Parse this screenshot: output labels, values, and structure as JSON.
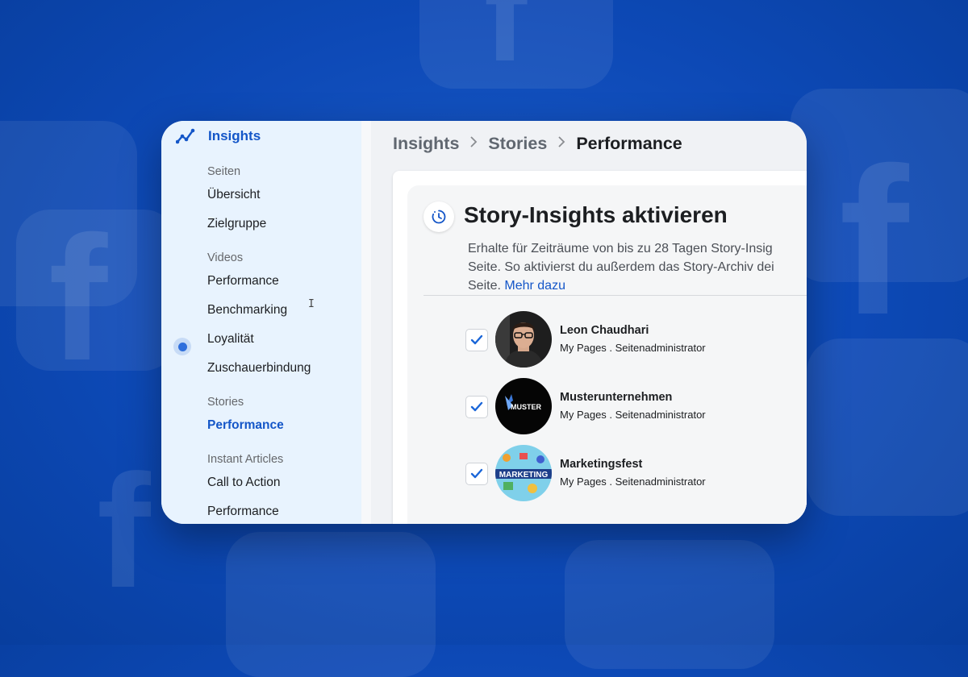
{
  "sidebar": {
    "brand_label": "Insights",
    "sections": [
      {
        "heading": "Seiten",
        "items": [
          "Übersicht",
          "Zielgruppe"
        ]
      },
      {
        "heading": "Videos",
        "items": [
          "Performance",
          "Benchmarking",
          "Loyalität",
          "Zuschauerbindung"
        ]
      },
      {
        "heading": "Stories",
        "items": [
          "Performance"
        ]
      },
      {
        "heading": "Instant Articles",
        "items": [
          "Call to Action",
          "Performance"
        ]
      }
    ],
    "active_item": "Stories › Performance"
  },
  "breadcrumb": {
    "items": [
      "Insights",
      "Stories",
      "Performance"
    ],
    "separator": ">"
  },
  "panel": {
    "title": "Story-Insights aktivieren",
    "description_line1": "Erhalte für Zeiträume von bis zu 28 Tagen Story-Insig",
    "description_line2": "Seite. So aktivierst du außerdem das Story-Archiv dei",
    "description_line3": "Seite.",
    "more_link": "Mehr dazu",
    "pages": [
      {
        "name": "Leon Chaudhari",
        "role": "My Pages . Seitenadministrator",
        "checked": true,
        "avatar_icon": "person-photo-icon"
      },
      {
        "name": "Musterunternehmen",
        "role": "My Pages . Seitenadministrator",
        "checked": true,
        "avatar_icon": "muster-logo-icon",
        "avatar_text": "MUSTER"
      },
      {
        "name": "Marketingsfest",
        "role": "My Pages . Seitenadministrator",
        "checked": true,
        "avatar_icon": "marketing-logo-icon",
        "avatar_text": "MARKETING"
      }
    ]
  },
  "colors": {
    "background": "#0d49b6",
    "sidebar": "#e8f3fe",
    "accent": "#1456c8",
    "active_dot": "#2f6fdc"
  }
}
